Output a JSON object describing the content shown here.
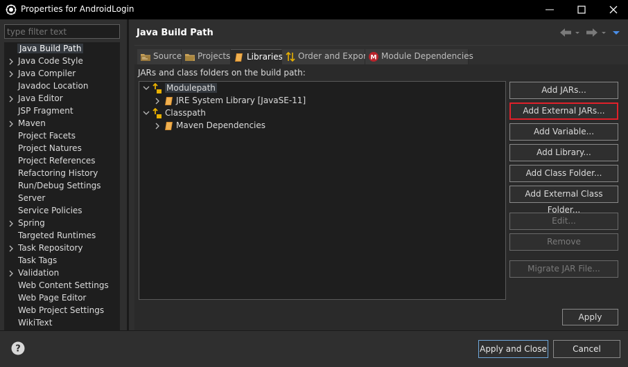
{
  "window": {
    "title": "Properties for AndroidLogin",
    "controls": {
      "minimize": "minimize-icon",
      "maximize": "maximize-icon",
      "close": "close-icon"
    }
  },
  "sidebar": {
    "filter_placeholder": "type filter text",
    "items": [
      {
        "label": "Java Build Path",
        "expandable": false,
        "selected": true
      },
      {
        "label": "Java Code Style",
        "expandable": true
      },
      {
        "label": "Java Compiler",
        "expandable": true
      },
      {
        "label": "Javadoc Location",
        "expandable": false
      },
      {
        "label": "Java Editor",
        "expandable": true
      },
      {
        "label": "JSP Fragment",
        "expandable": false
      },
      {
        "label": "Maven",
        "expandable": true
      },
      {
        "label": "Project Facets",
        "expandable": false
      },
      {
        "label": "Project Natures",
        "expandable": false
      },
      {
        "label": "Project References",
        "expandable": false
      },
      {
        "label": "Refactoring History",
        "expandable": false
      },
      {
        "label": "Run/Debug Settings",
        "expandable": false
      },
      {
        "label": "Server",
        "expandable": false
      },
      {
        "label": "Service Policies",
        "expandable": false
      },
      {
        "label": "Spring",
        "expandable": true
      },
      {
        "label": "Targeted Runtimes",
        "expandable": false
      },
      {
        "label": "Task Repository",
        "expandable": true
      },
      {
        "label": "Task Tags",
        "expandable": false
      },
      {
        "label": "Validation",
        "expandable": true
      },
      {
        "label": "Web Content Settings",
        "expandable": false
      },
      {
        "label": "Web Page Editor",
        "expandable": false
      },
      {
        "label": "Web Project Settings",
        "expandable": false
      },
      {
        "label": "WikiText",
        "expandable": false
      }
    ]
  },
  "page": {
    "title": "Java Build Path",
    "tabs": [
      {
        "label": "Source",
        "icon": "source-folder-icon",
        "active": false
      },
      {
        "label": "Projects",
        "icon": "projects-folder-icon",
        "active": false
      },
      {
        "label": "Libraries",
        "icon": "library-book-icon",
        "active": true
      },
      {
        "label": "Order and Export",
        "icon": "order-arrows-icon",
        "active": false
      },
      {
        "label": "Module Dependencies",
        "icon": "module-m-icon",
        "active": false
      }
    ],
    "jars_label": "JARs and class folders on the build path:",
    "tree": [
      {
        "label": "Modulepath",
        "level": 0,
        "expanded": true,
        "icon": "classpath-container-icon",
        "selected": true
      },
      {
        "label": "JRE System Library [JavaSE-11]",
        "level": 1,
        "expanded": false,
        "icon": "library-book-icon"
      },
      {
        "label": "Classpath",
        "level": 0,
        "expanded": true,
        "icon": "classpath-container-icon"
      },
      {
        "label": "Maven Dependencies",
        "level": 1,
        "expanded": false,
        "icon": "library-book-icon"
      }
    ],
    "buttons": {
      "add_jars": "Add JARs...",
      "add_external_jars": "Add External JARs...",
      "add_variable": "Add Variable...",
      "add_library": "Add Library...",
      "add_class_folder": "Add Class Folder...",
      "add_external_class_folder": "Add External Class Folder...",
      "edit": "Edit...",
      "remove": "Remove",
      "migrate_jar": "Migrate JAR File..."
    },
    "apply": "Apply"
  },
  "footer": {
    "help_icon": "help-question-icon",
    "apply_and_close": "Apply and Close",
    "cancel": "Cancel"
  },
  "colors": {
    "highlight_border": "#e0202a",
    "background": "#2f2f2f",
    "tree_background": "#1e1e1e",
    "title_bar": "#000000"
  }
}
